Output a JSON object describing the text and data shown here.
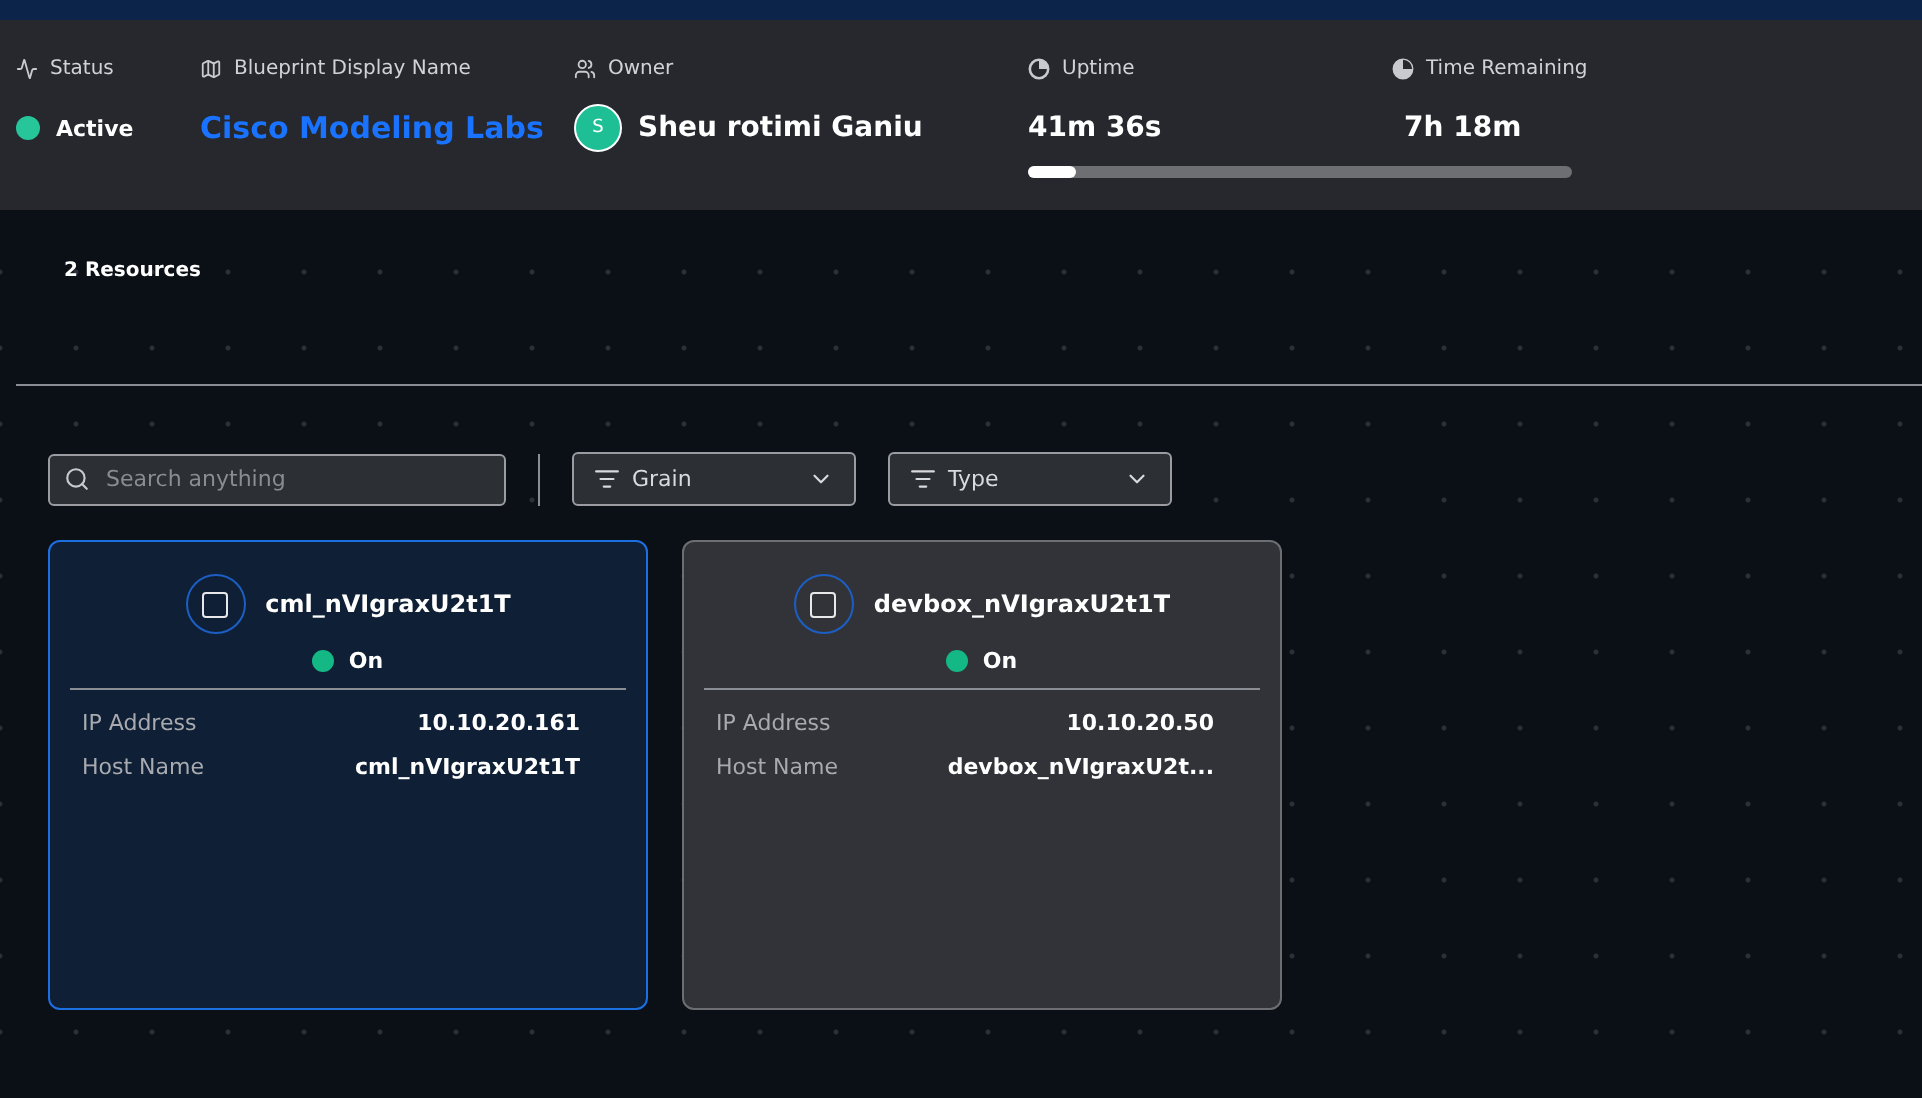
{
  "header": {
    "status": {
      "label": "Status",
      "value": "Active",
      "color": "#26c69a"
    },
    "blueprint": {
      "label": "Blueprint Display Name",
      "value": "Cisco Modeling Labs"
    },
    "owner": {
      "label": "Owner",
      "initial": "S",
      "name": "Sheu rotimi Ganiu"
    },
    "uptime": {
      "label": "Uptime",
      "value": "41m 36s",
      "level": 0.09
    },
    "remaining": {
      "label": "Time Remaining",
      "value": "7h 18m"
    }
  },
  "resources_count": "2 Resources",
  "search": {
    "placeholder": "Search anything"
  },
  "filters": [
    {
      "label": "Grain"
    },
    {
      "label": "Type"
    }
  ],
  "cards": [
    {
      "name": "cml_nVIgraxU2t1T",
      "selected": true,
      "checked": false,
      "state": "On",
      "fields": [
        {
          "label": "IP Address",
          "value": "10.10.20.161"
        },
        {
          "label": "Host Name",
          "value": "cml_nVIgraxU2t1T"
        }
      ]
    },
    {
      "name": "devbox_nVIgraxU2t1T",
      "selected": false,
      "checked": false,
      "state": "On",
      "fields": [
        {
          "label": "IP Address",
          "value": "10.10.20.50"
        },
        {
          "label": "Host Name",
          "value": "devbox_nVIgraxU2t..."
        }
      ]
    }
  ]
}
